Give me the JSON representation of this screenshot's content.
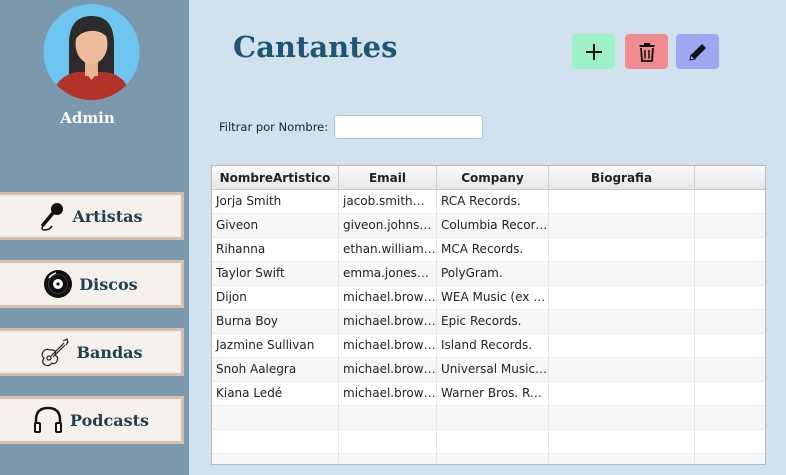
{
  "sidebar": {
    "user_label": "Admin",
    "nav": [
      {
        "label": "Artistas",
        "icon": "microphone-icon"
      },
      {
        "label": "Discos",
        "icon": "vinyl-disc-icon"
      },
      {
        "label": "Bandas",
        "icon": "guitar-icon"
      },
      {
        "label": "Podcasts",
        "icon": "headphones-icon"
      }
    ]
  },
  "header": {
    "title": "Cantantes",
    "buttons": {
      "add": {
        "glyph": "+",
        "icon": "plus-icon",
        "color": "#9ef0c7"
      },
      "delete": {
        "icon": "trash-icon",
        "color": "#f08b8f"
      },
      "edit": {
        "icon": "pencil-icon",
        "color": "#9fa7f2"
      }
    }
  },
  "filter": {
    "label": "Filtrar por Nombre:",
    "value": ""
  },
  "table": {
    "columns": [
      "NombreArtistico",
      "Email",
      "Company",
      "Biografia",
      ""
    ],
    "rows": [
      [
        "Jorja Smith",
        "jacob.smith@e...",
        "RCA Records.",
        "",
        ""
      ],
      [
        "Giveon",
        "giveon.johnson...",
        "Columbia Record...",
        "",
        ""
      ],
      [
        "Rihanna",
        "ethan.williams...",
        "MCA Records.",
        "",
        ""
      ],
      [
        "Taylor Swift",
        "emma.jones@e...",
        "PolyGram.",
        "",
        ""
      ],
      [
        "Dijon",
        "michael.brown...",
        "WEA Music (ex W...",
        "",
        ""
      ],
      [
        "Burna Boy",
        "michael.brown...",
        "Epic Records.",
        "",
        ""
      ],
      [
        "Jazmine Sullivan",
        "michael.brown...",
        "Island Records.",
        "",
        ""
      ],
      [
        "Snoh Aalegra",
        "michael.brown...",
        "Universal Music G...",
        "",
        ""
      ],
      [
        "Kiana Ledé",
        "michael.brown...",
        "Warner Bros. Rec...",
        "",
        ""
      ]
    ],
    "empty_rows": 3
  },
  "colors": {
    "background": "#d2e1ee",
    "sidebar": "#7c98ad",
    "title": "#1e5570",
    "nav_button": "#f4f1ec"
  }
}
